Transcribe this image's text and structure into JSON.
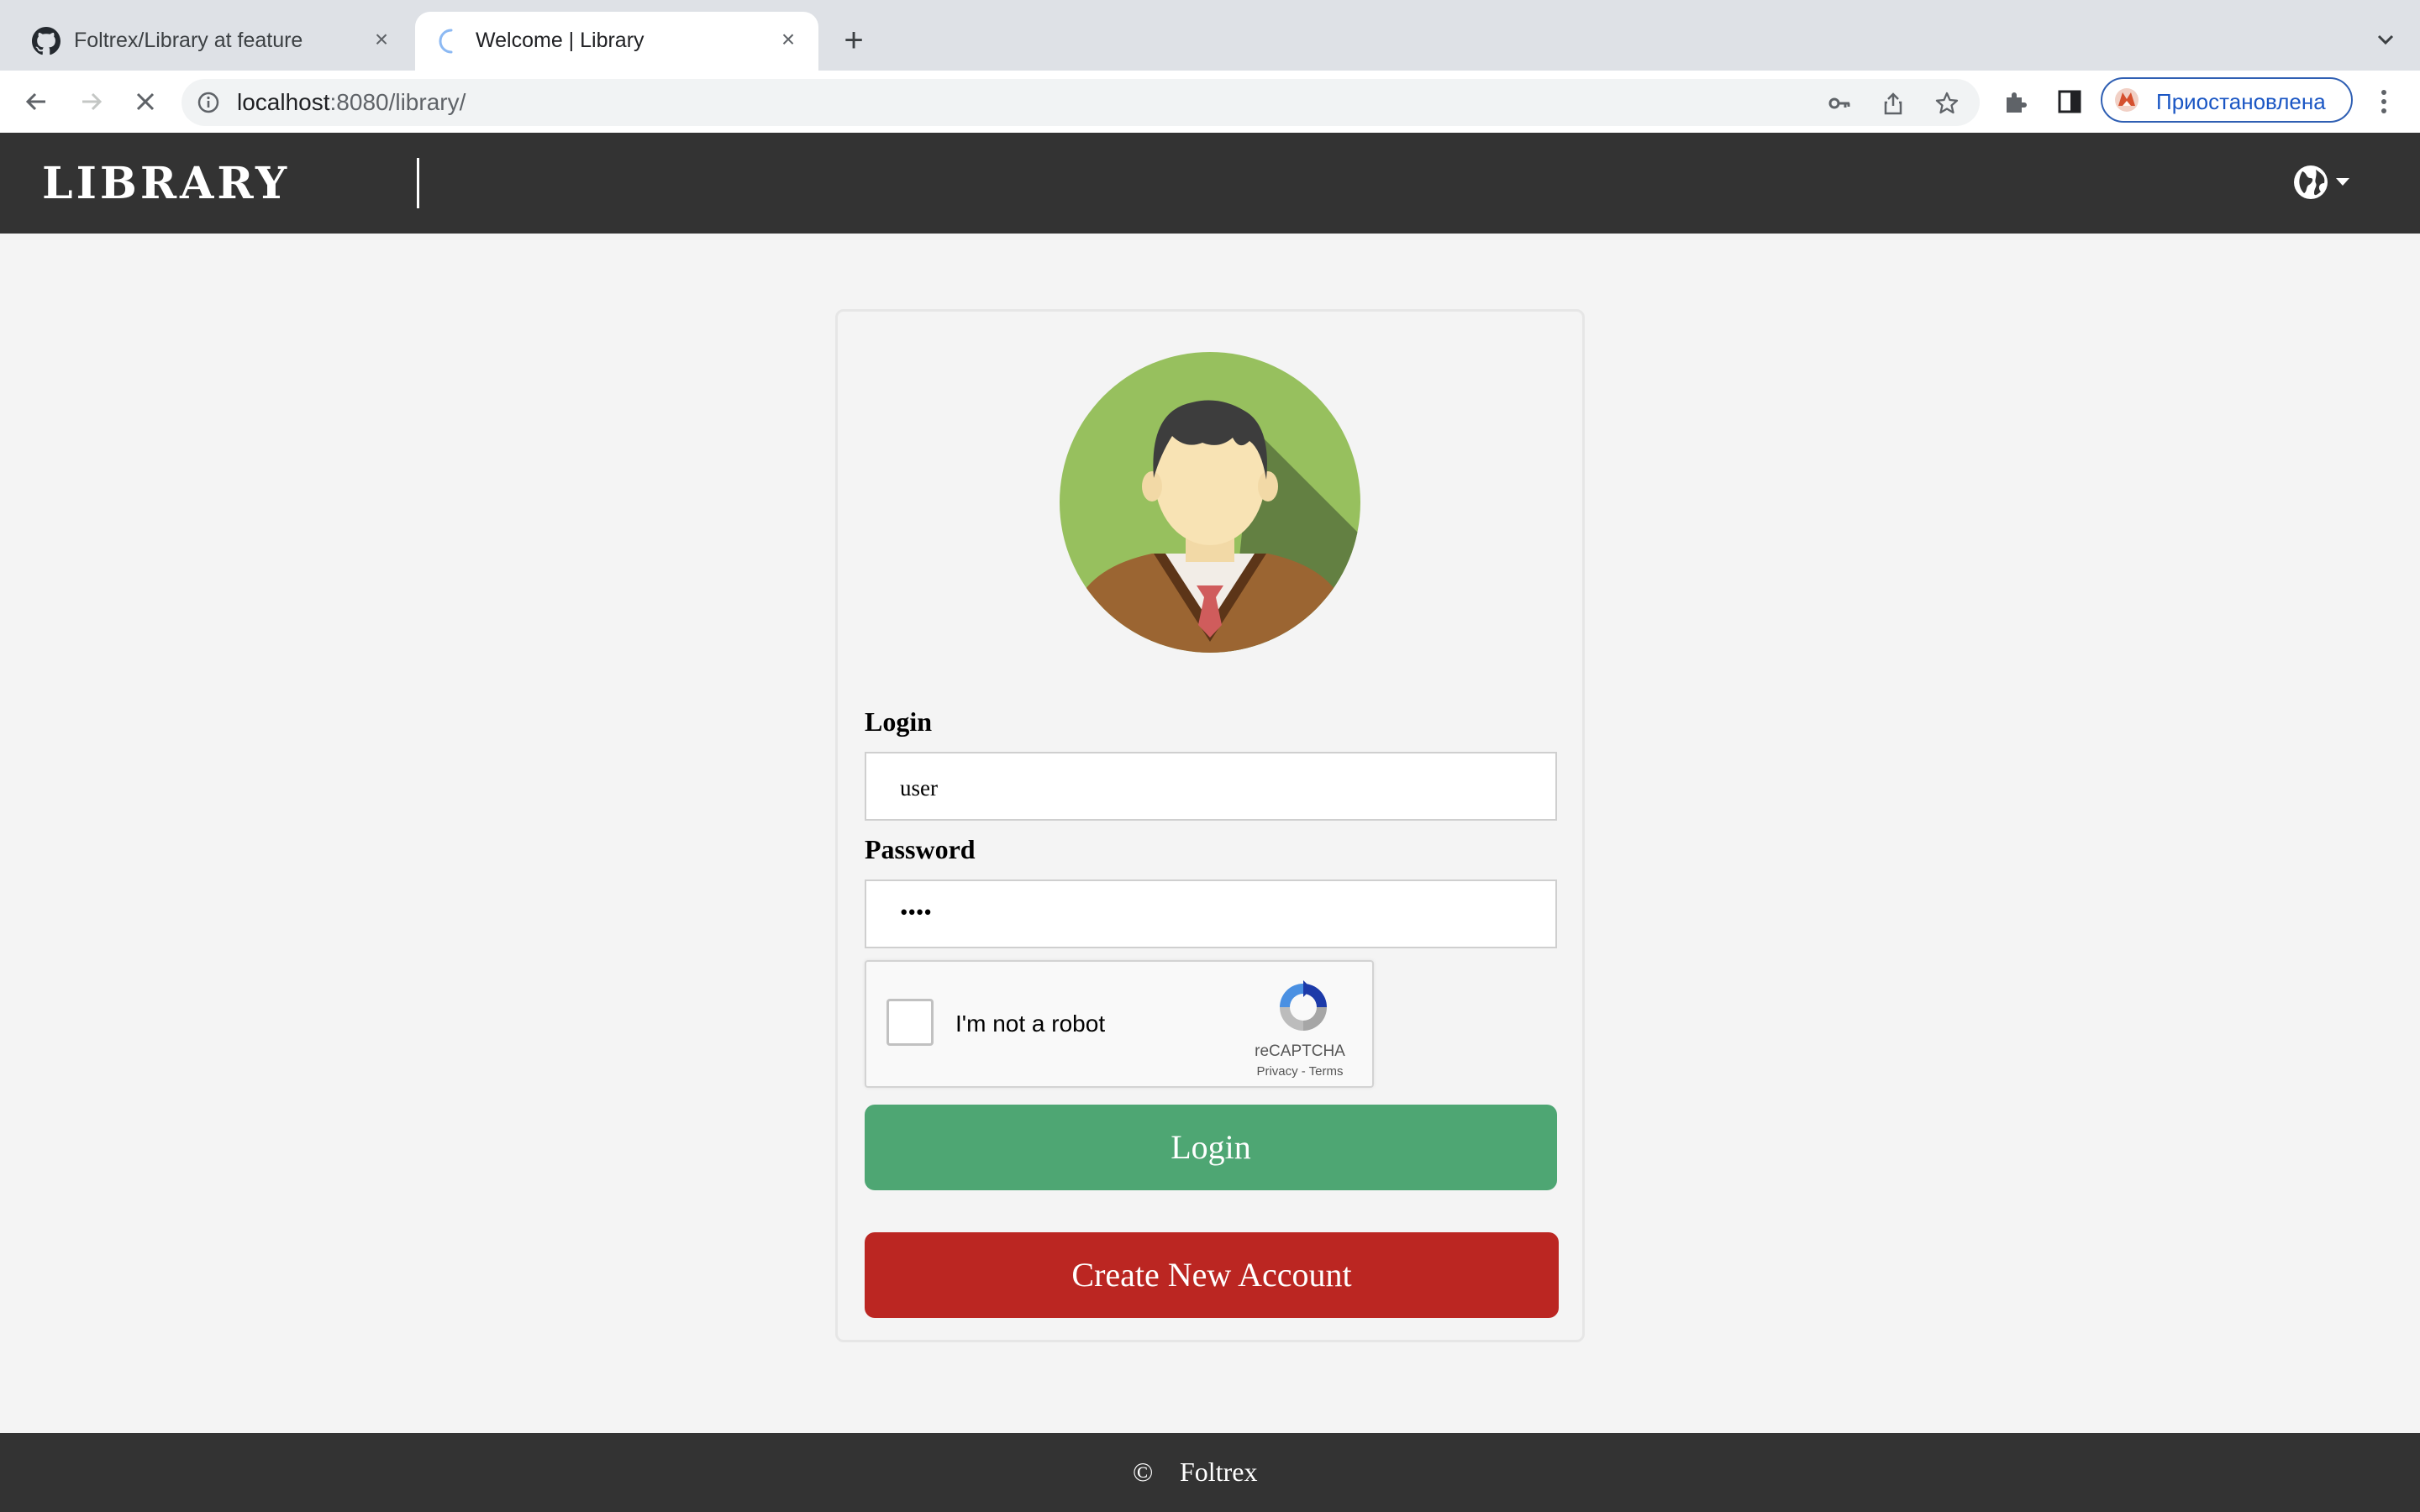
{
  "browser": {
    "tabs": [
      {
        "title": "Foltrex/Library at feature",
        "active": false,
        "favicon": "github-icon"
      },
      {
        "title": "Welcome | Library",
        "active": true,
        "favicon": "loading-spinner-icon"
      }
    ],
    "url_host": "localhost",
    "url_rest": ":8080/library/",
    "profile_label": "Приостановлена"
  },
  "header": {
    "logo": "LIBRARY",
    "lang_icon": "globe-icon"
  },
  "login_form": {
    "login_label": "Login",
    "login_value": "user",
    "password_label": "Password",
    "password_value": "••••",
    "captcha_text": "I'm not a robot",
    "captcha_brand": "reCAPTCHA",
    "captcha_links": "Privacy - Terms",
    "login_button": "Login",
    "create_button": "Create New Account"
  },
  "footer": {
    "copyright_symbol": "©",
    "owner": "Foltrex"
  },
  "colors": {
    "header_bg": "#333333",
    "login_button": "#4ea673",
    "create_button": "#bb2622",
    "page_bg": "#f4f4f4"
  }
}
